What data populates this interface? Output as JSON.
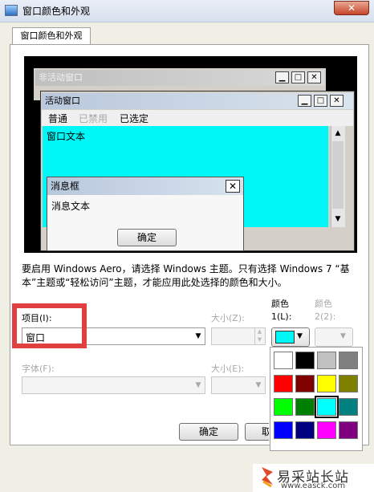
{
  "window": {
    "title": "窗口颜色和外观",
    "close_glyph": "✕"
  },
  "tab": {
    "label": "窗口颜色和外观"
  },
  "preview": {
    "inactive_title": "非活动窗口",
    "active_title": "活动窗口",
    "menu": {
      "normal": "普通",
      "disabled": "已禁用",
      "selected": "已选定"
    },
    "window_text": "窗口文本",
    "message_box": {
      "title": "消息框",
      "text": "消息文本",
      "ok": "确定"
    },
    "title_buttons": {
      "minimize": "▁",
      "maximize": "□",
      "close": "✕"
    }
  },
  "description": "要启用 Windows Aero，请选择 Windows 主题。只有选择 Windows 7 “基本”主题或“轻松访问”主题，才能应用此处选择的颜色和大小。",
  "item": {
    "label": "项目(I):",
    "value": "窗口"
  },
  "size1": {
    "label": "大小(Z):",
    "value": ""
  },
  "color1": {
    "label": "颜色",
    "label2": "1(L):",
    "value_color": "#00f7f7"
  },
  "color2": {
    "label": "颜色",
    "label2": "2(2):"
  },
  "font": {
    "label": "字体(F):",
    "value": ""
  },
  "size2": {
    "label": "大小(E):",
    "value": ""
  },
  "palette": {
    "colors": [
      "#ffffff",
      "#000000",
      "#c0c0c0",
      "#808080",
      "#ff0000",
      "#800000",
      "#ffff00",
      "#808000",
      "#00ff00",
      "#008000",
      "#00ffff",
      "#008080",
      "#0000ff",
      "#000080",
      "#ff00ff",
      "#800080"
    ],
    "selected_index": 10
  },
  "buttons": {
    "ok": "确定",
    "cancel": "取"
  },
  "watermark": {
    "big": "易采站长站",
    "small": "www.easck.com"
  },
  "icons": {
    "dropdown": "▼",
    "spin_up": "▲",
    "spin_down": "▼",
    "scroll_up": "▲",
    "scroll_down": "▼"
  }
}
